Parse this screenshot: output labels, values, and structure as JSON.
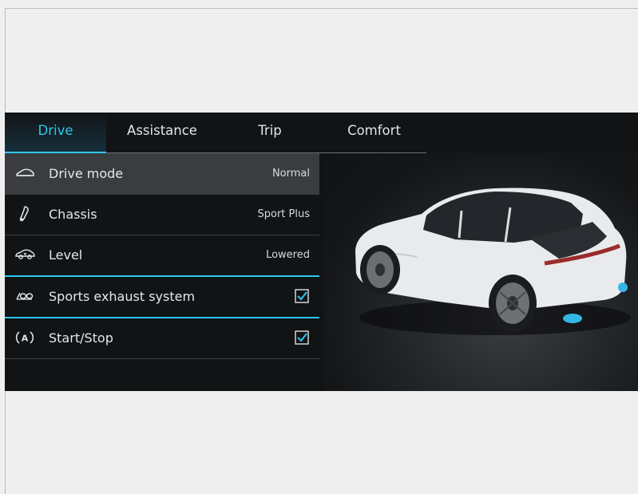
{
  "tabs": [
    {
      "label": "Drive",
      "active": true
    },
    {
      "label": "Assistance",
      "active": false
    },
    {
      "label": "Trip",
      "active": false
    },
    {
      "label": "Comfort",
      "active": false
    }
  ],
  "settings": [
    {
      "icon": "car-front-icon",
      "label": "Drive mode",
      "value": "Normal",
      "selected": true
    },
    {
      "icon": "chassis-icon",
      "label": "Chassis",
      "value": "Sport Plus"
    },
    {
      "icon": "level-icon",
      "label": "Level",
      "value": "Lowered"
    },
    {
      "icon": "exhaust-icon",
      "label": "Sports exhaust system",
      "checked": true
    },
    {
      "icon": "auto-start-stop-icon",
      "label": "Start/Stop",
      "checked": true
    }
  ],
  "colors": {
    "accent": "#2cc7ee",
    "screen_bg": "#111315",
    "selected_row": "#3a3c3f",
    "car_body": "#e8eaec"
  }
}
